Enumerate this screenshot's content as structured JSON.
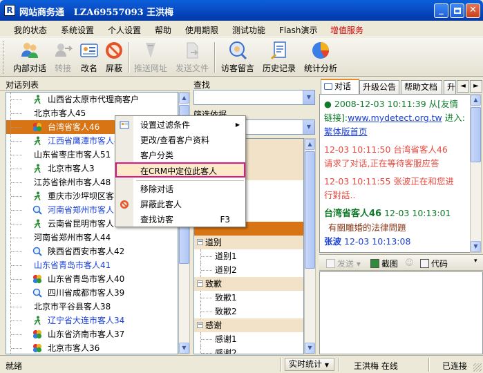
{
  "window": {
    "title": "网站商务通   LZA69557093 王洪梅",
    "icon_letter": "R"
  },
  "menubar": [
    {
      "label": "我的状态"
    },
    {
      "label": "系统设置"
    },
    {
      "label": "个人设置"
    },
    {
      "label": "帮助"
    },
    {
      "label": "使用期限"
    },
    {
      "label": "测试功能"
    },
    {
      "label": "Flash演示"
    },
    {
      "label": "增值服务",
      "color": "#d40000"
    }
  ],
  "toolbar": [
    {
      "label": "内部对话",
      "icon": "users-icon",
      "enabled": true
    },
    {
      "label": "转接",
      "icon": "transfer-icon",
      "enabled": false
    },
    {
      "label": "改名",
      "icon": "rename-card-icon",
      "enabled": true
    },
    {
      "label": "屏蔽",
      "icon": "block-icon",
      "enabled": true
    },
    {
      "label": "推送网址",
      "icon": "push-url-icon",
      "enabled": false
    },
    {
      "label": "发送文件",
      "icon": "send-file-icon",
      "enabled": false
    },
    {
      "label": "访客留言",
      "icon": "visitor-message-icon",
      "enabled": true
    },
    {
      "label": "历史记录",
      "icon": "history-icon",
      "enabled": true
    },
    {
      "label": "统计分析",
      "icon": "statistics-icon",
      "enabled": true
    }
  ],
  "left_panel": {
    "header": "对话列表",
    "rows": [
      {
        "text": "山西省太原市代理商客户",
        "icon": "walker"
      },
      {
        "text": "北京市客人45",
        "icon": "none"
      },
      {
        "text": "台湾省客人46",
        "icon": "balls",
        "selected": true
      },
      {
        "text": "江西省鹰潭市客人4",
        "icon": "walker",
        "blue": true
      },
      {
        "text": "山东省枣庄市客人51",
        "icon": "none"
      },
      {
        "text": "北京市客人3",
        "icon": "walker"
      },
      {
        "text": "江苏省徐州市客人48",
        "icon": "none"
      },
      {
        "text": "重庆市沙坪坝区客",
        "icon": "walker"
      },
      {
        "text": "河南省郑州市客人",
        "icon": "search",
        "blue": true
      },
      {
        "text": "云南省昆明市客人",
        "icon": "walker"
      },
      {
        "text": "河南省郑州市客人44",
        "icon": "none"
      },
      {
        "text": "陕西省西安市客人42",
        "icon": "search"
      },
      {
        "text": "山东省青岛市客人41",
        "icon": "none",
        "blue": true
      },
      {
        "text": "山东省青岛市客人40",
        "icon": "balls"
      },
      {
        "text": "四川省成都市客人39",
        "icon": "search"
      },
      {
        "text": "北京市平谷县客人38",
        "icon": "none"
      },
      {
        "text": "辽宁省大连市客人34",
        "icon": "walker",
        "blue": true
      },
      {
        "text": "山东省济南市客人37",
        "icon": "balls"
      },
      {
        "text": "北京市客人36",
        "icon": "balls"
      }
    ]
  },
  "middle_panel": {
    "find_label": "查找",
    "filter_label": "筛选依据",
    "tree": [
      {
        "text": "",
        "type": "cat"
      },
      {
        "text": "",
        "type": "cat"
      },
      {
        "text": "",
        "type": "cat"
      },
      {
        "text": "电话",
        "type": "child"
      },
      {
        "text": "",
        "type": "blank"
      },
      {
        "text": "",
        "type": "blank"
      },
      {
        "text": "",
        "type": "catsel"
      },
      {
        "text": "道别",
        "type": "cat",
        "exp": "−"
      },
      {
        "text": "道别1",
        "type": "child"
      },
      {
        "text": "道别2",
        "type": "child"
      },
      {
        "text": "致歉",
        "type": "cat",
        "exp": "−"
      },
      {
        "text": "致歉1",
        "type": "child"
      },
      {
        "text": "致歉2",
        "type": "child"
      },
      {
        "text": "感谢",
        "type": "cat",
        "exp": "−"
      },
      {
        "text": "感谢1",
        "type": "child"
      },
      {
        "text": "感谢2",
        "type": "child"
      }
    ]
  },
  "right_panel": {
    "tabs": [
      {
        "label": "对话",
        "active": true
      },
      {
        "label": "升级公告"
      },
      {
        "label": "帮助文档"
      },
      {
        "label": "升"
      }
    ],
    "messages": {
      "m1_time": "2008-12-03 10:11:39 从[友情链接]:",
      "m1_url": "www.mydetect.org.tw",
      "m1_enter": " 进入:",
      "m1_page": "繁体版首页",
      "m2_head": "12-03 10:11:50  台湾省客人46",
      "m2_body": "请求了对话,正在等待客服应答",
      "m3_head": "12-03 10:11:55  张波正在和您进",
      "m3_body": "行對話..",
      "m4_name": "台湾省客人46",
      "m4_time": " 12-03 10:13:01",
      "m4_body": "有關雕婚的法律問題",
      "m5_name": "张波",
      "m5_time": " 12-03 10:13:08"
    },
    "chat_toolbar": {
      "send": "发送",
      "screenshot": "截图",
      "code": "代码"
    }
  },
  "context_menu": [
    {
      "label": "设置过滤条件",
      "submenu": true
    },
    {
      "label": "更改/查看客户资料"
    },
    {
      "label": "客户分类"
    },
    {
      "label": "在CRM中定位此客人",
      "highlighted": true
    },
    {
      "label": "移除对话"
    },
    {
      "label": "屏蔽此客人"
    },
    {
      "label": "查找访客",
      "shortcut": "F3"
    }
  ],
  "statusbar": {
    "ready": "就绪",
    "realtime": "实时统计",
    "user_status": "王洪梅 在线",
    "connection": "已连接"
  }
}
